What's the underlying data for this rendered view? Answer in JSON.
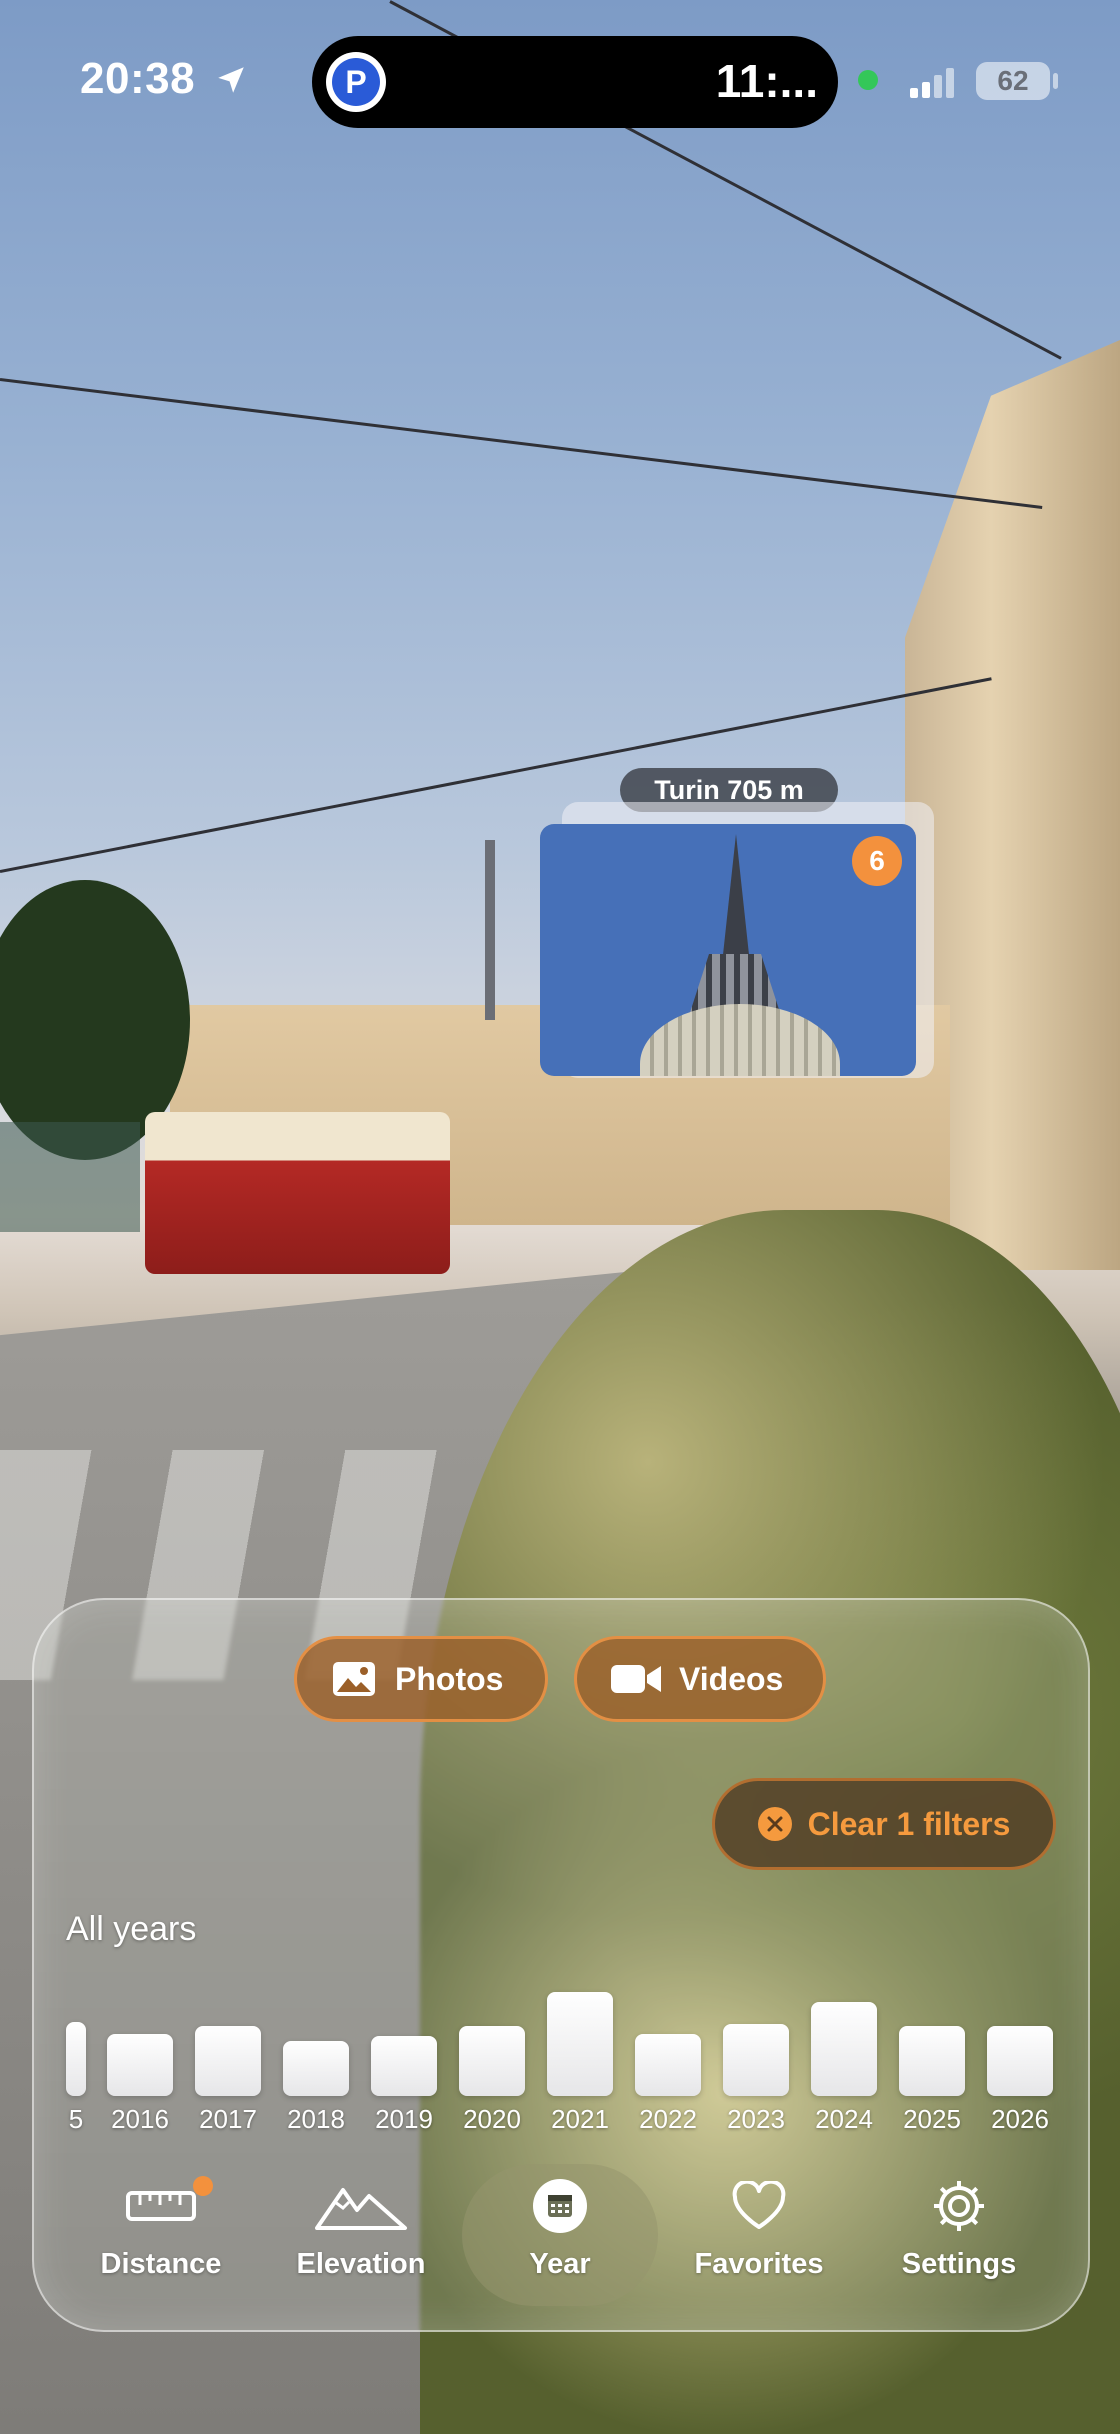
{
  "status_bar": {
    "time": "20:38",
    "island_timer": "11:...",
    "battery": "62"
  },
  "map_pin": {
    "label": "Turin 705 m",
    "count": "6"
  },
  "filters": {
    "photos_label": "Photos",
    "videos_label": "Videos",
    "clear_label": "Clear 1 filters"
  },
  "year_selector": {
    "title": "All years"
  },
  "chart_data": {
    "type": "bar",
    "categories": [
      "5",
      "2016",
      "2017",
      "2018",
      "2019",
      "2020",
      "2021",
      "2022",
      "2023",
      "2024",
      "2025",
      "2026"
    ],
    "values": [
      74,
      62,
      70,
      55,
      60,
      70,
      104,
      62,
      72,
      94,
      70,
      70
    ],
    "ylim": [
      0,
      110
    ]
  },
  "tab_bar": {
    "items": [
      {
        "label": "Distance",
        "icon": "ruler-icon"
      },
      {
        "label": "Elevation",
        "icon": "mountains-icon"
      },
      {
        "label": "Year",
        "icon": "calendar-icon"
      },
      {
        "label": "Favorites",
        "icon": "heart-icon"
      },
      {
        "label": "Settings",
        "icon": "gear-icon"
      }
    ],
    "active": "Year"
  },
  "colors": {
    "accent": "#f59a3e",
    "chip_fill": "#9b5f28"
  }
}
